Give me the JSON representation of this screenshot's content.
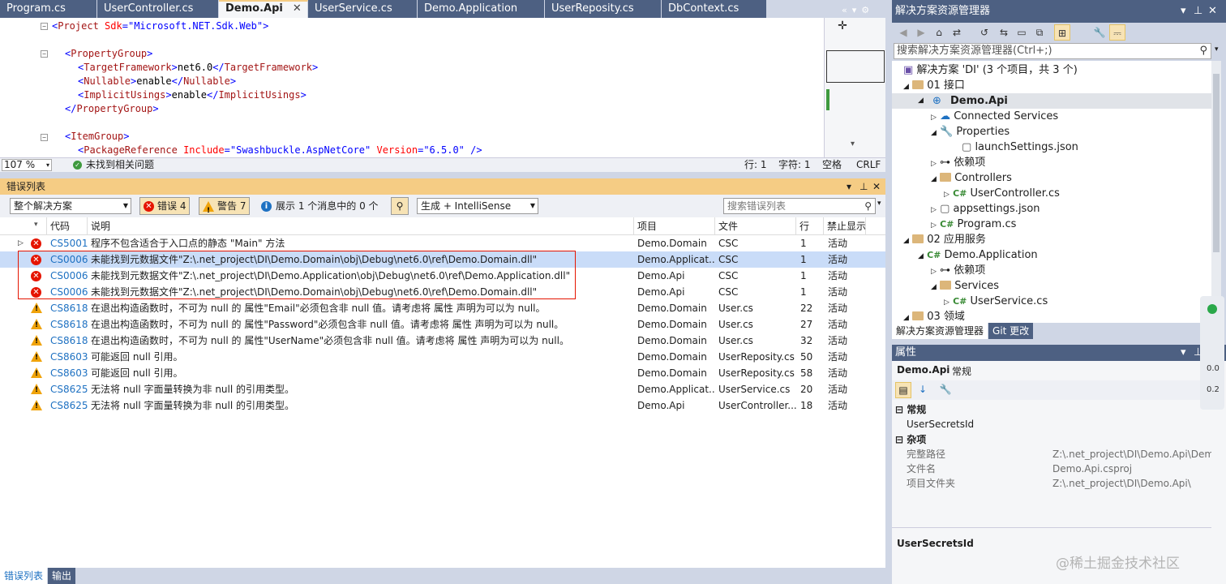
{
  "tabs": [
    {
      "label": "Program.cs",
      "active": false
    },
    {
      "label": "UserController.cs",
      "active": false
    },
    {
      "label": "Demo.Api",
      "active": true
    },
    {
      "label": "UserService.cs",
      "active": false
    },
    {
      "label": "Demo.Application",
      "active": false
    },
    {
      "label": "UserReposity.cs",
      "active": false
    },
    {
      "label": "DbContext.cs",
      "active": false
    }
  ],
  "editor": {
    "zoom": "107 %",
    "issues": "未找到相关问题",
    "line": "行: 1",
    "col": "字符: 1",
    "ws": "空格",
    "eol": "CRLF"
  },
  "errorList": {
    "title": "错误列表",
    "scope": "整个解决方案",
    "errors_btn": "错误 4",
    "warnings_btn": "警告 7",
    "messages_btn": "展示 1 个消息中的 0 个",
    "build": "生成 + IntelliSense",
    "search_placeholder": "搜索错误列表",
    "headers": {
      "code": "代码",
      "desc": "说明",
      "project": "项目",
      "file": "文件",
      "line": "行",
      "suppress": "禁止显示..."
    },
    "rows": [
      {
        "type": "error",
        "code": "CS5001",
        "desc": "程序不包含适合于入口点的静态 \"Main\" 方法",
        "project": "Demo.Domain",
        "file": "CSC",
        "line": "1",
        "state": "活动"
      },
      {
        "type": "error",
        "code": "CS0006",
        "desc": "未能找到元数据文件\"Z:\\.net_project\\DI\\Demo.Domain\\obj\\Debug\\net6.0\\ref\\Demo.Domain.dll\"",
        "project": "Demo.Applicat...",
        "file": "CSC",
        "line": "1",
        "state": "活动"
      },
      {
        "type": "error",
        "code": "CS0006",
        "desc": "未能找到元数据文件\"Z:\\.net_project\\DI\\Demo.Application\\obj\\Debug\\net6.0\\ref\\Demo.Application.dll\"",
        "project": "Demo.Api",
        "file": "CSC",
        "line": "1",
        "state": "活动"
      },
      {
        "type": "error",
        "code": "CS0006",
        "desc": "未能找到元数据文件\"Z:\\.net_project\\DI\\Demo.Domain\\obj\\Debug\\net6.0\\ref\\Demo.Domain.dll\"",
        "project": "Demo.Api",
        "file": "CSC",
        "line": "1",
        "state": "活动"
      },
      {
        "type": "warning",
        "code": "CS8618",
        "desc": "在退出构造函数时，不可为 null 的 属性\"Email\"必须包含非 null 值。请考虑将 属性 声明为可以为 null。",
        "project": "Demo.Domain",
        "file": "User.cs",
        "line": "22",
        "state": "活动"
      },
      {
        "type": "warning",
        "code": "CS8618",
        "desc": "在退出构造函数时，不可为 null 的 属性\"Password\"必须包含非 null 值。请考虑将 属性 声明为可以为 null。",
        "project": "Demo.Domain",
        "file": "User.cs",
        "line": "27",
        "state": "活动"
      },
      {
        "type": "warning",
        "code": "CS8618",
        "desc": "在退出构造函数时，不可为 null 的 属性\"UserName\"必须包含非 null 值。请考虑将 属性 声明为可以为 null。",
        "project": "Demo.Domain",
        "file": "User.cs",
        "line": "32",
        "state": "活动"
      },
      {
        "type": "warning",
        "code": "CS8603",
        "desc": "可能返回 null 引用。",
        "project": "Demo.Domain",
        "file": "UserReposity.cs",
        "line": "50",
        "state": "活动"
      },
      {
        "type": "warning",
        "code": "CS8603",
        "desc": "可能返回 null 引用。",
        "project": "Demo.Domain",
        "file": "UserReposity.cs",
        "line": "58",
        "state": "活动"
      },
      {
        "type": "warning",
        "code": "CS8625",
        "desc": "无法将 null 字面量转换为非 null 的引用类型。",
        "project": "Demo.Applicat...",
        "file": "UserService.cs",
        "line": "20",
        "state": "活动"
      },
      {
        "type": "warning",
        "code": "CS8625",
        "desc": "无法将 null 字面量转换为非 null 的引用类型。",
        "project": "Demo.Api",
        "file": "UserController...",
        "line": "18",
        "state": "活动"
      }
    ]
  },
  "bottomTabs": [
    "错误列表",
    "输出"
  ],
  "solution": {
    "title": "解决方案资源管理器",
    "search_placeholder": "搜索解决方案资源管理器(Ctrl+;)",
    "tree": [
      "解决方案 'DI' (3 个项目，共 3 个)",
      "01 接口",
      "Demo.Api",
      "Connected Services",
      "Properties",
      "launchSettings.json",
      "依赖项",
      "Controllers",
      "UserController.cs",
      "appsettings.json",
      "Program.cs",
      "02 应用服务",
      "Demo.Application",
      "依赖项",
      "Services",
      "UserService.cs",
      "03 领域"
    ],
    "tabs": [
      "解决方案资源管理器",
      "Git 更改"
    ]
  },
  "properties": {
    "title": "属性",
    "object": "Demo.Api",
    "object_type": "常规",
    "cat1": "常规",
    "cat2": "杂项",
    "rows": [
      {
        "k": "UserSecretsId",
        "v": ""
      },
      {
        "k": "完整路径",
        "v": "Z:\\.net_project\\DI\\Demo.Api\\Demo"
      },
      {
        "k": "文件名",
        "v": "Demo.Api.csproj"
      },
      {
        "k": "项目文件夹",
        "v": "Z:\\.net_project\\DI\\Demo.Api\\"
      }
    ],
    "desc_title": "UserSecretsId"
  },
  "net": {
    "a": "0.0",
    "b": "0.2"
  },
  "watermark": "@稀土掘金技术社区"
}
